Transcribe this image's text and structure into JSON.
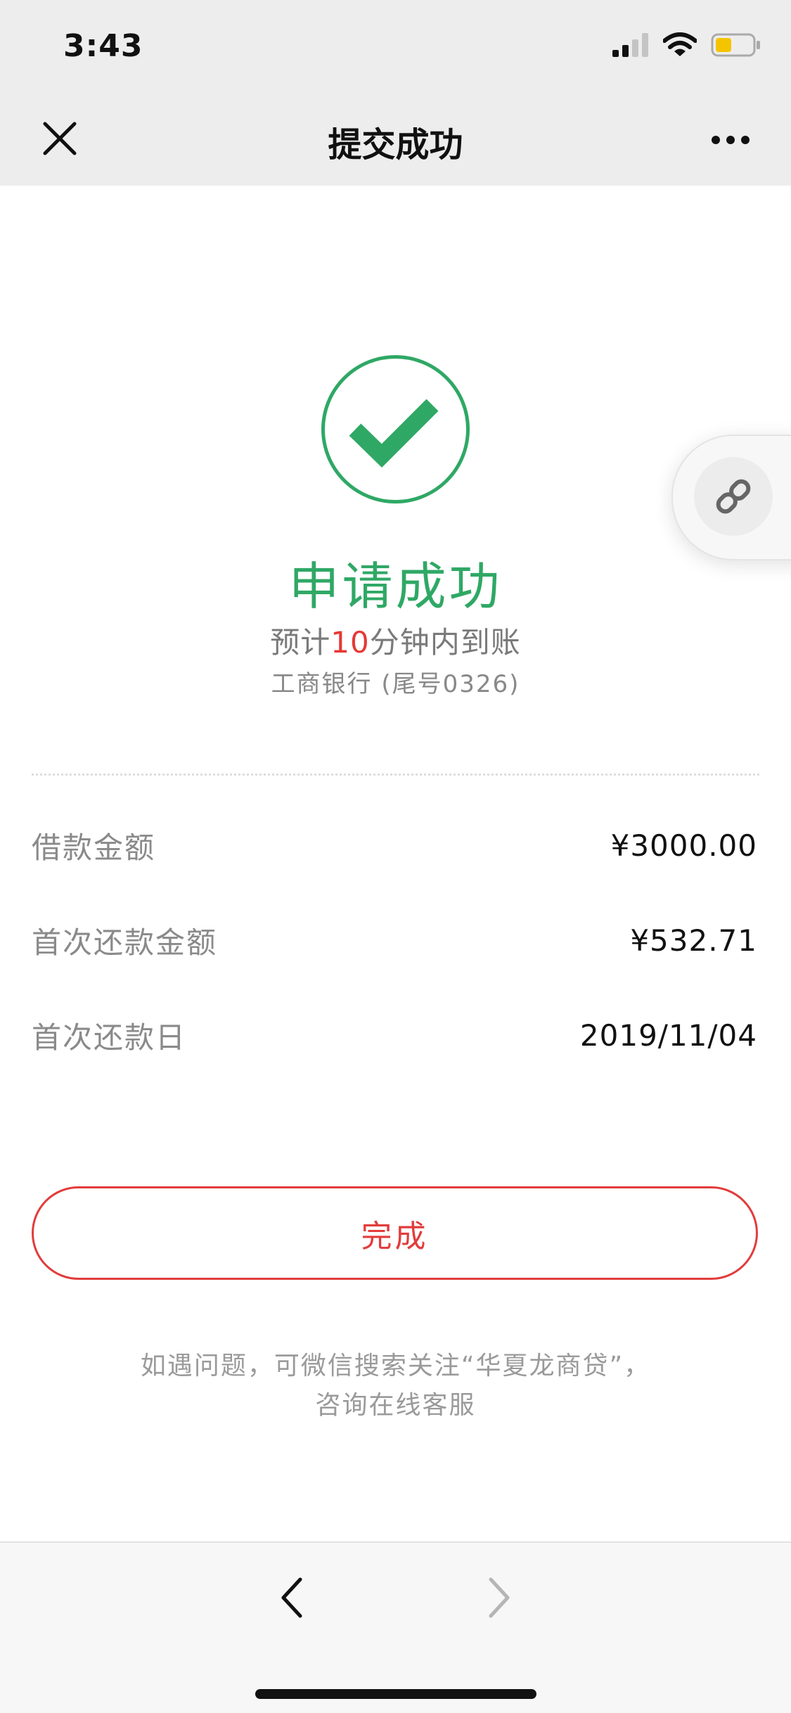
{
  "status_bar": {
    "time": "3:43"
  },
  "nav": {
    "title": "提交成功"
  },
  "result": {
    "title": "申请成功",
    "eta_prefix": "预计",
    "eta_minutes": "10",
    "eta_suffix": "分钟内到账",
    "bank_info": "工商银行 (尾号0326)"
  },
  "details": [
    {
      "label": "借款金额",
      "value": "¥3000.00"
    },
    {
      "label": "首次还款金额",
      "value": "¥532.71"
    },
    {
      "label": "首次还款日",
      "value": "2019/11/04"
    }
  ],
  "actions": {
    "done_label": "完成"
  },
  "help": {
    "line1": "如遇问题，可微信搜索关注“华夏龙商贷”，",
    "line2": "咨询在线客服"
  },
  "colors": {
    "success_green": "#2fa865",
    "accent_red": "#e23c3c",
    "battery_yellow": "#f5c400"
  },
  "icons": {
    "close": "close-icon",
    "more": "more-icon",
    "success": "check-circle-icon",
    "link": "link-icon",
    "back": "chevron-left-icon",
    "forward": "chevron-right-icon"
  }
}
